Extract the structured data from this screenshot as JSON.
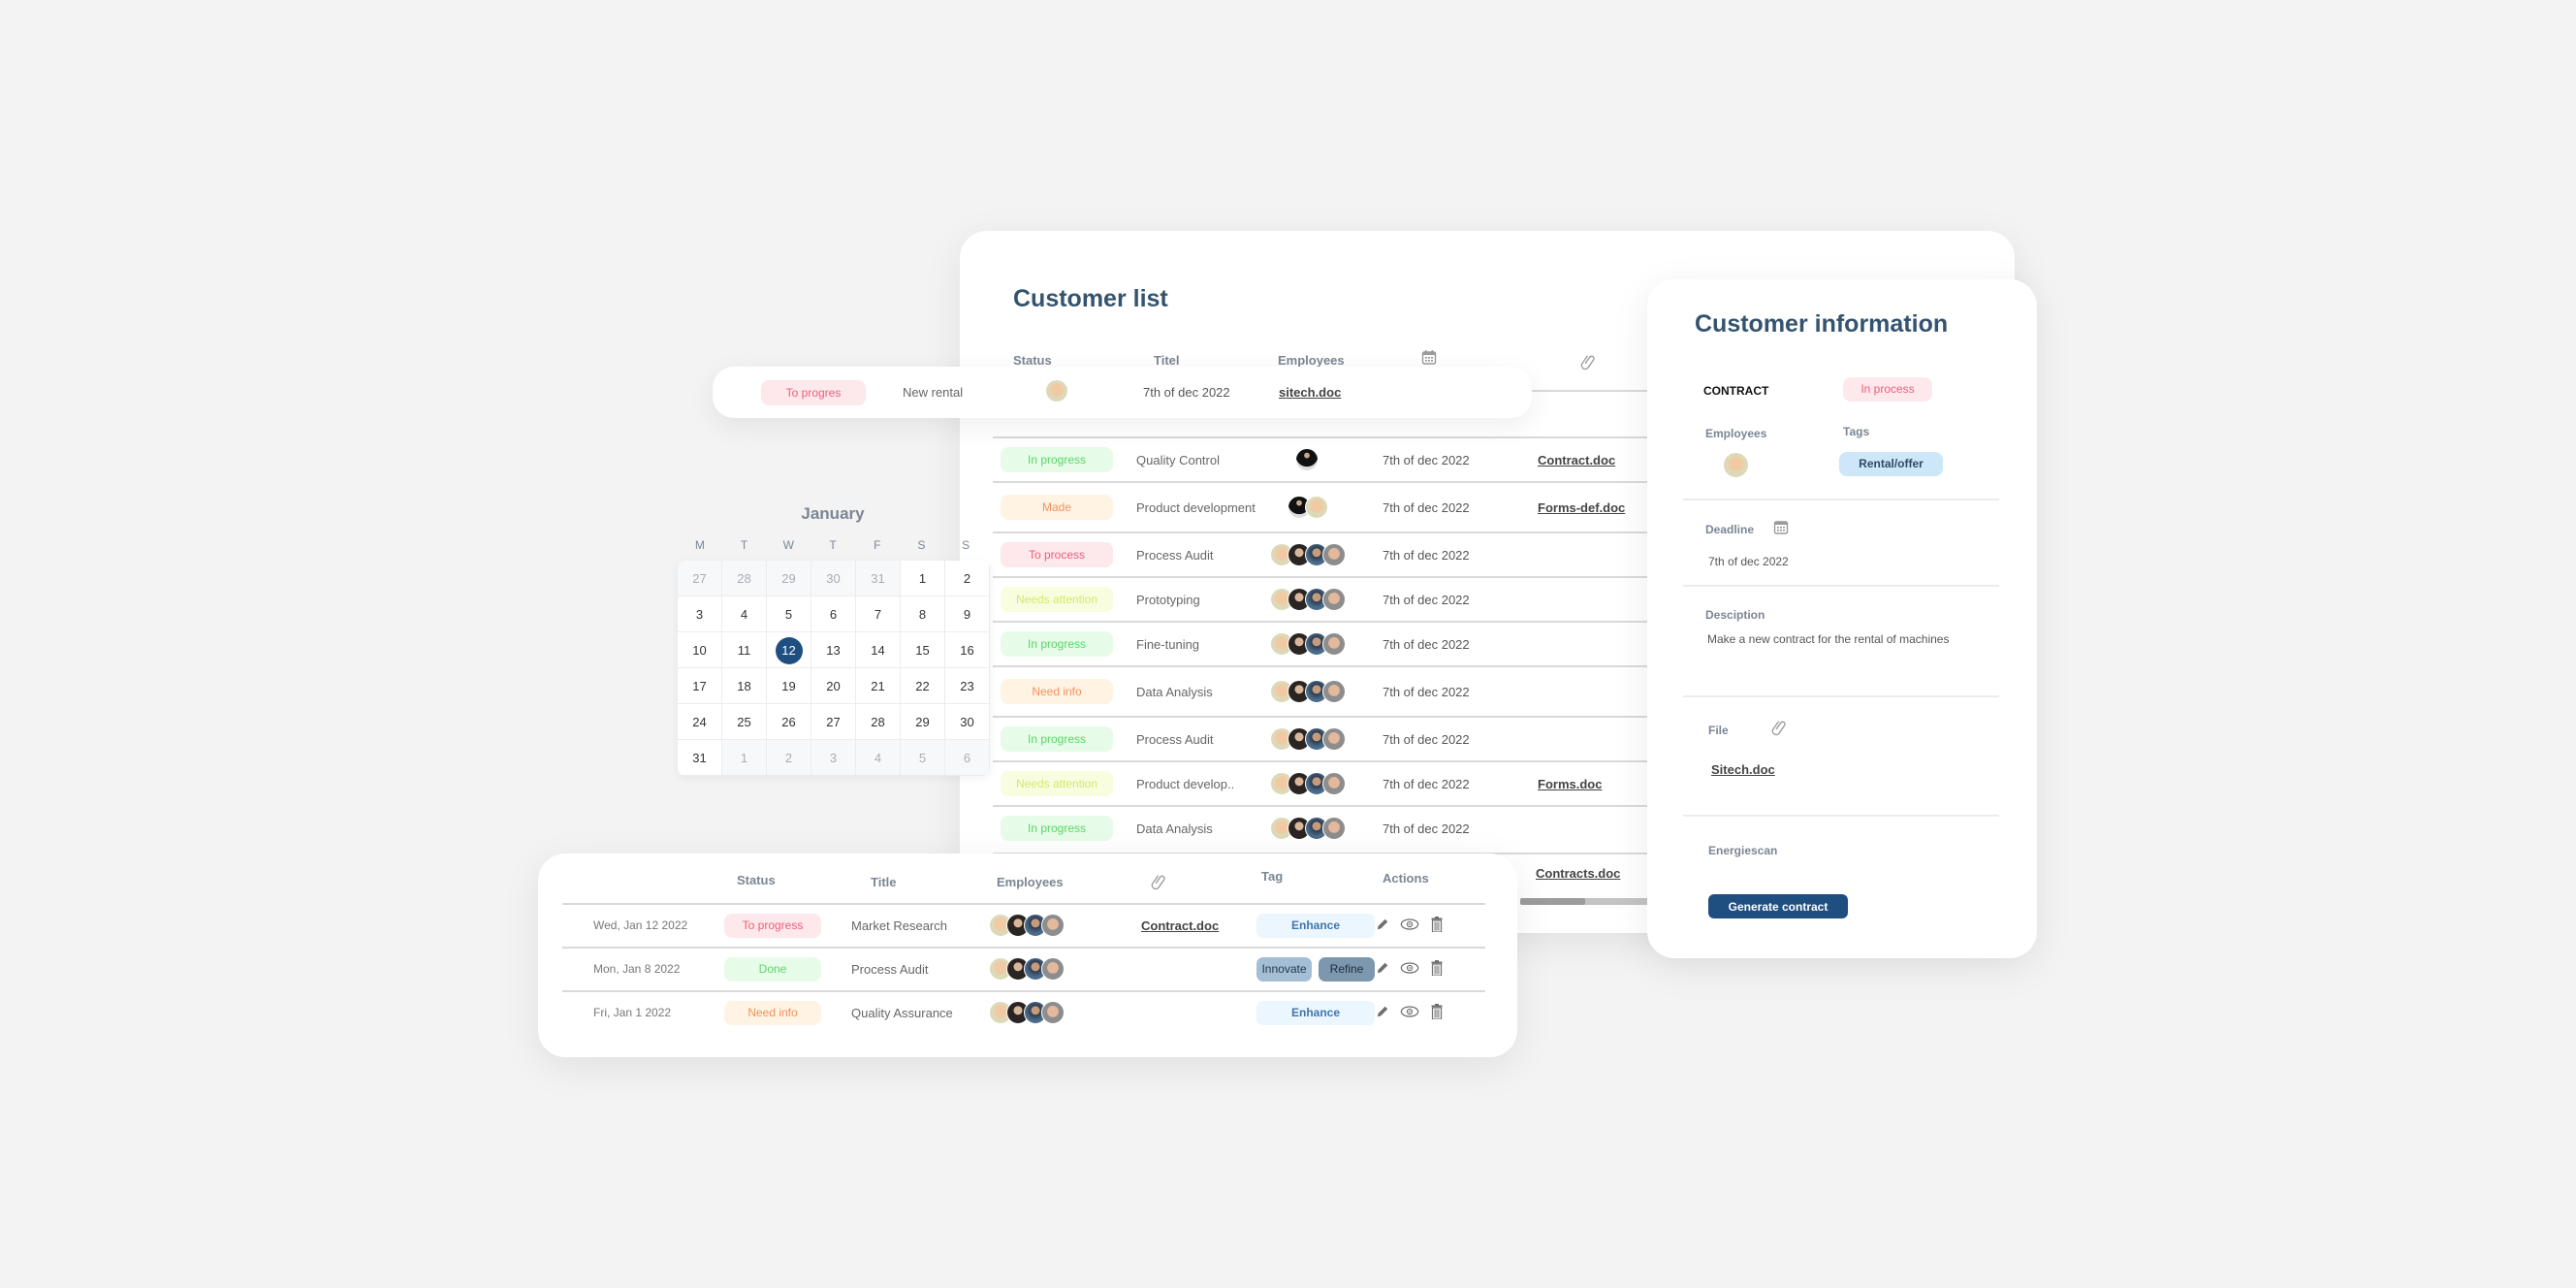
{
  "customer_list": {
    "title": "Customer list",
    "headers": {
      "status": "Status",
      "title": "Titel",
      "employees": "Employees",
      "date_icon": "calendar-icon",
      "file_icon": "paperclip-icon"
    },
    "rows": [
      {
        "status": "In progress",
        "status_color": "green",
        "title": "Quality Control",
        "employees": [
          "a5"
        ],
        "date": "7th of dec 2022",
        "file": "Contract.doc"
      },
      {
        "status": "Made",
        "status_color": "orange",
        "title": "Product development",
        "employees": [
          "a5",
          "a1"
        ],
        "date": "7th of dec 2022",
        "file": "Forms-def.doc"
      },
      {
        "status": "To process",
        "status_color": "red",
        "title": "Process Audit",
        "employees": [
          "a1",
          "a2",
          "a3",
          "a4"
        ],
        "date": "7th of dec 2022",
        "file": ""
      },
      {
        "status": "Needs attention",
        "status_color": "lime",
        "title": "Prototyping",
        "employees": [
          "a1",
          "a2",
          "a3",
          "a4"
        ],
        "date": "7th of dec 2022",
        "file": ""
      },
      {
        "status": "In progress",
        "status_color": "green",
        "title": "Fine-tuning",
        "employees": [
          "a1",
          "a2",
          "a3",
          "a4"
        ],
        "date": "7th of dec 2022",
        "file": ""
      },
      {
        "status": "Need info",
        "status_color": "orange",
        "title": "Data Analysis",
        "employees": [
          "a1",
          "a2",
          "a3",
          "a4"
        ],
        "date": "7th of dec 2022",
        "file": ""
      },
      {
        "status": "In progress",
        "status_color": "green",
        "title": "Process Audit",
        "employees": [
          "a1",
          "a2",
          "a3",
          "a4"
        ],
        "date": "7th of dec 2022",
        "file": ""
      },
      {
        "status": "Needs attention",
        "status_color": "lime",
        "title": "Product develop..",
        "employees": [
          "a1",
          "a2",
          "a3",
          "a4"
        ],
        "date": "7th of dec 2022",
        "file": "Forms.doc"
      },
      {
        "status": "In progress",
        "status_color": "green",
        "title": "Data  Analysis",
        "employees": [
          "a1",
          "a2",
          "a3",
          "a4"
        ],
        "date": "7th of dec 2022",
        "file": ""
      }
    ],
    "last_row_file": "Contracts.doc",
    "scroll_position": 0.5
  },
  "floating_row": {
    "status": "To progres",
    "title": "New rental",
    "date": "7th of dec 2022",
    "file": "sitech.doc"
  },
  "customer_info": {
    "title": "Customer information",
    "contract_label": "CONTRACT",
    "status": "In process",
    "employees_label": "Employees",
    "tags_label": "Tags",
    "tag": "Rental/offer",
    "deadline_label": "Deadline",
    "deadline": "7th of dec 2022",
    "description_label": "Desciption",
    "description": "Make a new contract for the rental of machines",
    "file_label": "File",
    "file": "Sitech.doc",
    "energiescan_label": "Energiescan",
    "generate_button": "Generate contract"
  },
  "calendar": {
    "month": "January",
    "weekdays": [
      "M",
      "T",
      "W",
      "T",
      "F",
      "S",
      "S"
    ],
    "days": [
      {
        "d": "27",
        "m": true
      },
      {
        "d": "28",
        "m": true
      },
      {
        "d": "29",
        "m": true
      },
      {
        "d": "30",
        "m": true
      },
      {
        "d": "31",
        "m": true
      },
      {
        "d": "1"
      },
      {
        "d": "2"
      },
      {
        "d": "3"
      },
      {
        "d": "4"
      },
      {
        "d": "5"
      },
      {
        "d": "6"
      },
      {
        "d": "7"
      },
      {
        "d": "8"
      },
      {
        "d": "9"
      },
      {
        "d": "10"
      },
      {
        "d": "11"
      },
      {
        "d": "12",
        "sel": true
      },
      {
        "d": "13"
      },
      {
        "d": "14"
      },
      {
        "d": "15"
      },
      {
        "d": "16"
      },
      {
        "d": "17"
      },
      {
        "d": "18"
      },
      {
        "d": "19"
      },
      {
        "d": "20"
      },
      {
        "d": "21"
      },
      {
        "d": "22"
      },
      {
        "d": "23"
      },
      {
        "d": "24"
      },
      {
        "d": "25"
      },
      {
        "d": "26"
      },
      {
        "d": "27"
      },
      {
        "d": "28"
      },
      {
        "d": "29"
      },
      {
        "d": "30"
      },
      {
        "d": "31"
      },
      {
        "d": "1",
        "m": true
      },
      {
        "d": "2",
        "m": true
      },
      {
        "d": "3",
        "m": true
      },
      {
        "d": "4",
        "m": true
      },
      {
        "d": "5",
        "m": true
      },
      {
        "d": "6",
        "m": true
      }
    ],
    "selected": "12"
  },
  "bottom_table": {
    "headers": {
      "status": "Status",
      "title": "Title",
      "employees": "Employees",
      "file_icon": "paperclip-icon",
      "tag": "Tag",
      "actions": "Actions"
    },
    "rows": [
      {
        "date": "Wed, Jan 12 2022",
        "status": "To progress",
        "status_color": "red",
        "title": "Market Research",
        "file": "Contract.doc",
        "tags": [
          {
            "label": "Enhance",
            "kind": "enhance"
          }
        ]
      },
      {
        "date": "Mon, Jan 8 2022",
        "status": "Done",
        "status_color": "green",
        "title": "Process Audit",
        "file": "",
        "tags": [
          {
            "label": "Innovate",
            "kind": "innovate"
          },
          {
            "label": "Refine",
            "kind": "refine"
          }
        ]
      },
      {
        "date": "Fri, Jan 1 2022",
        "status": "Need info",
        "status_color": "orange",
        "title": "Quality Assurance",
        "file": "",
        "tags": [
          {
            "label": "Enhance",
            "kind": "enhance"
          }
        ]
      }
    ],
    "actions": [
      "pencil-icon",
      "eye-icon",
      "trash-icon"
    ]
  },
  "colors": {
    "heading": "#34536f",
    "primary": "#1f4f81",
    "status_red": "#ec5f7a",
    "status_green": "#5ad666",
    "status_orange": "#f2925c",
    "status_lime": "#d1ea6a"
  }
}
